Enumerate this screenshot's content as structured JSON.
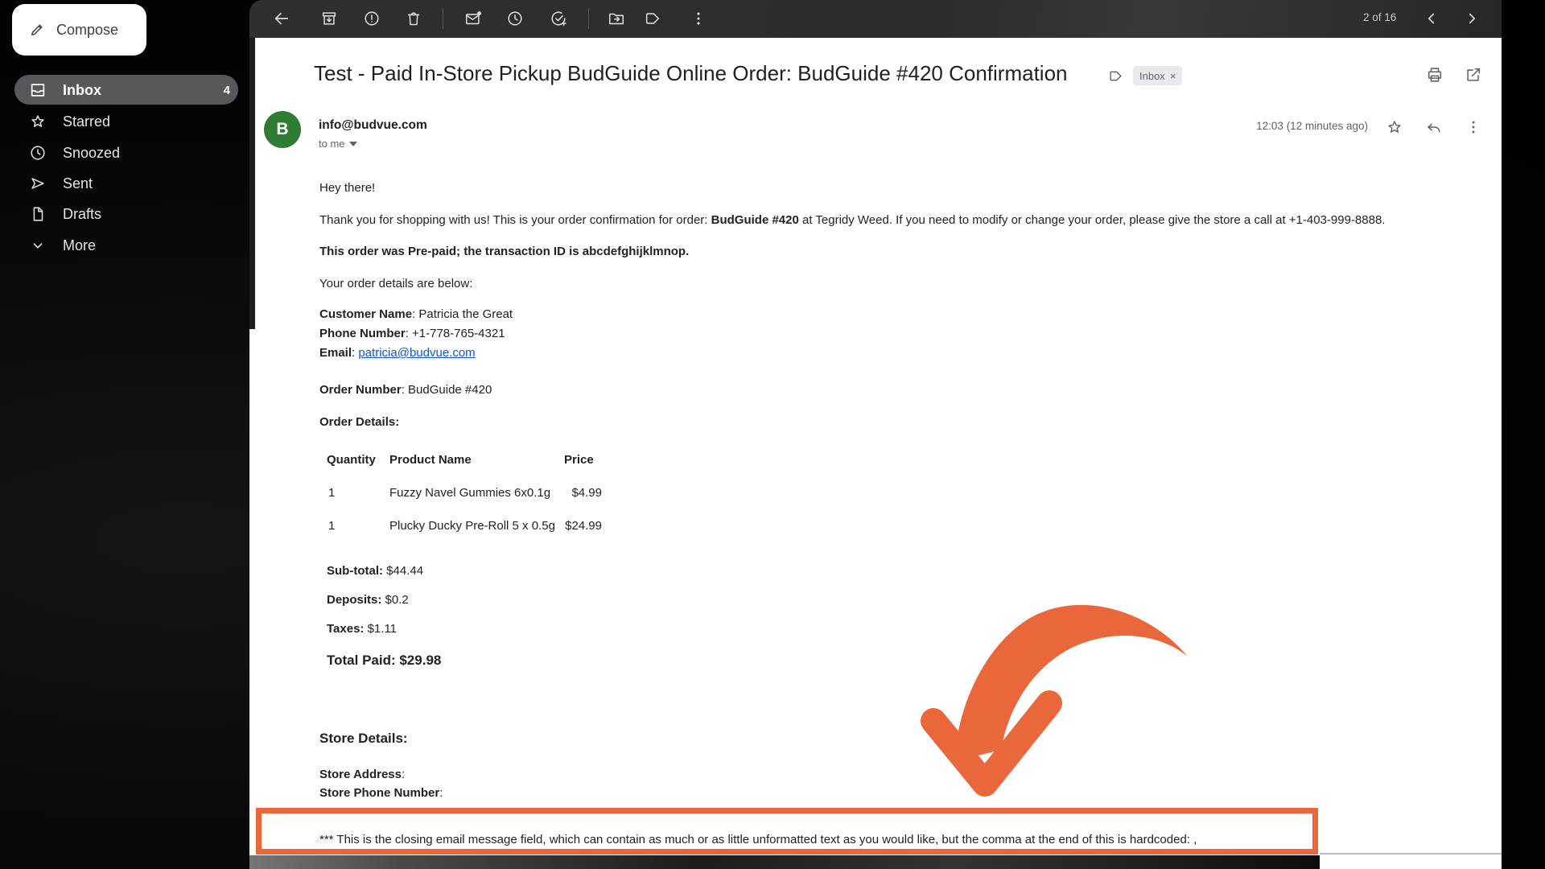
{
  "colors": {
    "accent": "#EA673C",
    "avatar_green": "#2e7d32",
    "link_blue": "#1155cc"
  },
  "toolbar": {
    "pagination": "2 of 16"
  },
  "sidebar": {
    "compose": "Compose",
    "items": [
      {
        "label": "Inbox",
        "count": "4"
      },
      {
        "label": "Starred"
      },
      {
        "label": "Snoozed"
      },
      {
        "label": "Sent"
      },
      {
        "label": "Drafts"
      },
      {
        "label": "More"
      }
    ]
  },
  "email": {
    "subject": "Test - Paid In-Store Pickup BudGuide Online Order: BudGuide #420 Confirmation",
    "chip": "Inbox",
    "chip_close": "×",
    "sender_initial": "B",
    "sender": "info@budvue.com",
    "to": "to me",
    "time": "12:03 (12 minutes ago)",
    "body": {
      "greeting": "Hey there!",
      "thanks_1": "Thank you for shopping with us! This is your order confirmation for order: ",
      "order_ref": "BudGuide #420",
      "thanks_2": " at Tegridy Weed. If you need to modify or change your order, please give the store a call at +1-403-999-8888.",
      "prepaid": "This order was Pre-paid; the transaction ID is abcdefghijklmnop.",
      "details_intro": "Your order details are below:",
      "customer_label": "Customer Name",
      "customer_value": ": Patricia the Great",
      "phone_label": "Phone Number",
      "phone_value": ": +1-778-765-4321",
      "email_label": "Email",
      "email_sep": ": ",
      "email_value": "patricia@budvue.com",
      "order_no_label": "Order Number",
      "order_no_value": ": BudGuide #420",
      "order_details_heading": "Order Details:",
      "table": {
        "headers": {
          "qty": "Quantity",
          "name": "Product Name",
          "price": "Price"
        },
        "rows": [
          {
            "qty": "1",
            "name": "Fuzzy Navel Gummies 6x0.1g",
            "price": "$4.99"
          },
          {
            "qty": "1",
            "name": "Plucky Ducky Pre-Roll 5 x 0.5g",
            "price": "$24.99"
          }
        ]
      },
      "subtotal_label": "Sub-total:",
      "subtotal_value": " $44.44",
      "deposits_label": "Deposits:",
      "deposits_value": " $0.2",
      "taxes_label": "Taxes:",
      "taxes_value": " $1.11",
      "total_label": "Total Paid: $29.98",
      "store_heading": "Store Details:",
      "store_address_label": "Store Address",
      "store_address_sep": ":",
      "store_phone_label": "Store Phone Number",
      "store_phone_sep": ":",
      "closing": "*** This is the closing email message field, which can contain as much or as little unformatted text as you would like, but the comma at the end of this is hardcoded: ,"
    }
  }
}
